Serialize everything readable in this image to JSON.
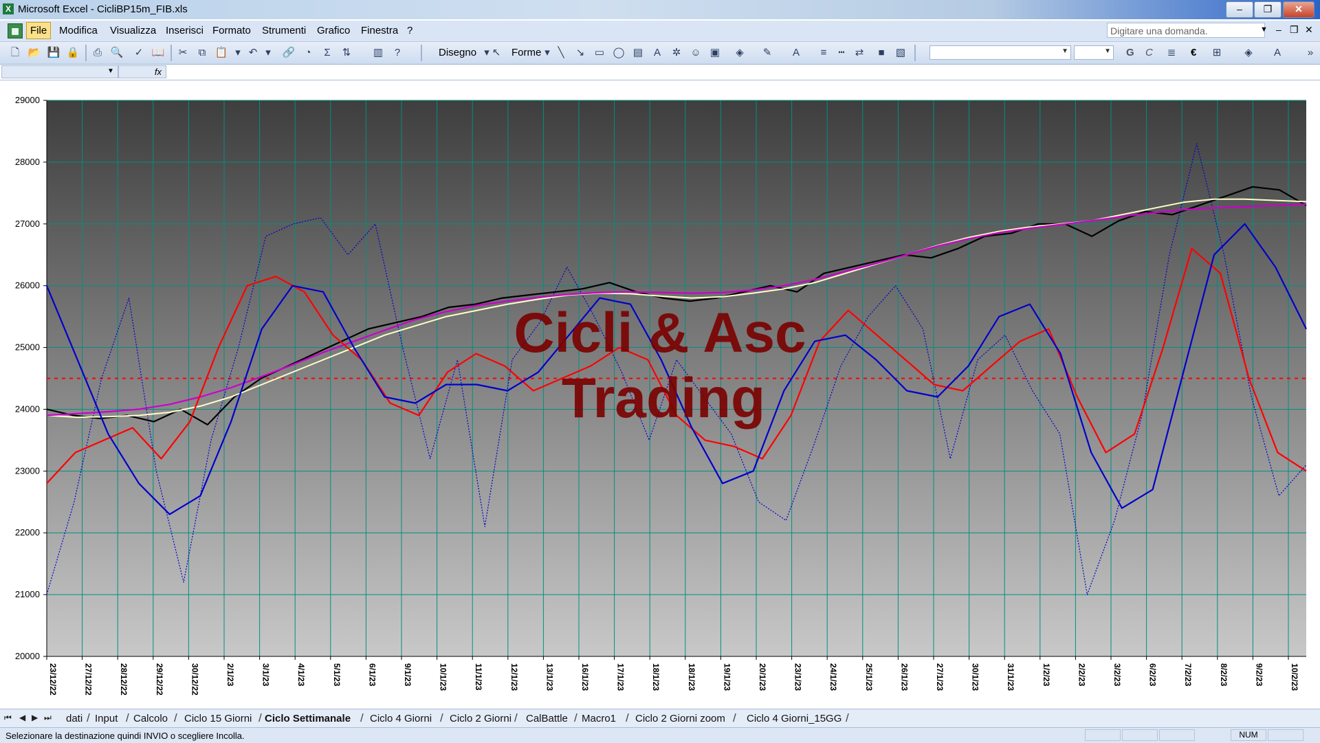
{
  "window": {
    "title": "Microsoft Excel - CicliBP15m_FIB.xls"
  },
  "menu": {
    "items": [
      "File",
      "Modifica",
      "Visualizza",
      "Inserisci",
      "Formato",
      "Strumenti",
      "Grafico",
      "Finestra",
      "?"
    ],
    "help_placeholder": "Digitare una domanda."
  },
  "toolbar": {
    "draw_label": "Disegno",
    "shapes_label": "Forme",
    "bold": "G",
    "italic": "C",
    "euro": "€"
  },
  "chart_data": {
    "type": "line",
    "title": "",
    "watermark": [
      "Cicli & Asc",
      "Trading"
    ],
    "y_ticks": [
      20000,
      21000,
      22000,
      23000,
      24000,
      25000,
      26000,
      27000,
      28000,
      29000
    ],
    "ylim": [
      20000,
      29000
    ],
    "x_tick_labels": [
      "23/12/22",
      "27/12/22",
      "28/12/22",
      "29/12/22",
      "30/12/22",
      "2/1/23",
      "3/1/23",
      "4/1/23",
      "5/1/23",
      "6/1/23",
      "9/1/23",
      "10/1/23",
      "11/1/23",
      "12/1/23",
      "13/1/23",
      "16/1/23",
      "17/1/23",
      "18/1/23",
      "18/1/23",
      "19/1/23",
      "20/1/23",
      "23/1/23",
      "24/1/23",
      "25/1/23",
      "26/1/23",
      "27/1/23",
      "30/1/23",
      "31/1/23",
      "1/2/23",
      "2/2/23",
      "3/2/23",
      "6/2/23",
      "7/2/23",
      "8/2/23",
      "9/2/23",
      "10/2/23"
    ],
    "reference_line": {
      "value": 24500,
      "color": "#ff0000",
      "style": "dashed"
    },
    "series": [
      {
        "color": "#000000",
        "style": "solid",
        "values": [
          24000,
          23900,
          23850,
          23900,
          23800,
          24000,
          23750,
          24200,
          24500,
          24700,
          24900,
          25100,
          25300,
          25400,
          25500,
          25650,
          25700,
          25800,
          25850,
          25900,
          25950,
          26050,
          25900,
          25800,
          25750,
          25800,
          25900,
          26000,
          25900,
          26200,
          26300,
          26400,
          26500,
          26450,
          26600,
          26800,
          26850,
          27000,
          27000,
          26800,
          27050,
          27200,
          27150,
          27300,
          27450,
          27600,
          27550,
          27300
        ]
      },
      {
        "color": "#ffffcc",
        "style": "solid",
        "values": [
          23900,
          23870,
          23880,
          23900,
          23950,
          24050,
          24200,
          24400,
          24600,
          24800,
          25000,
          25200,
          25350,
          25500,
          25600,
          25700,
          25780,
          25850,
          25880,
          25870,
          25830,
          25800,
          25820,
          25880,
          25950,
          26050,
          26200,
          26350,
          26500,
          26650,
          26780,
          26880,
          26950,
          27000,
          27050,
          27150,
          27250,
          27350,
          27400,
          27400,
          27380,
          27360
        ]
      },
      {
        "color": "#cc00cc",
        "style": "solid",
        "values": [
          23900,
          23930,
          23960,
          24000,
          24080,
          24200,
          24350,
          24530,
          24720,
          24920,
          25100,
          25280,
          25450,
          25580,
          25680,
          25750,
          25810,
          25860,
          25890,
          25900,
          25890,
          25880,
          25890,
          25930,
          26000,
          26100,
          26230,
          26360,
          26500,
          26640,
          26760,
          26860,
          26930,
          26990,
          27050,
          27120,
          27180,
          27230,
          27260,
          27280,
          27300,
          27320
        ]
      },
      {
        "color": "#ff0000",
        "style": "solid",
        "values": [
          22800,
          23300,
          23500,
          23700,
          23200,
          23800,
          25000,
          26000,
          26150,
          25900,
          25200,
          24800,
          24100,
          23900,
          24600,
          24900,
          24700,
          24300,
          24500,
          24700,
          25000,
          24800,
          23900,
          23500,
          23400,
          23200,
          23900,
          25100,
          25600,
          25200,
          24800,
          24400,
          24300,
          24700,
          25100,
          25300,
          24200,
          23300,
          23600,
          25000,
          26600,
          26200,
          24500,
          23300,
          23000
        ]
      },
      {
        "color": "#0000cc",
        "style": "solid",
        "values": [
          26000,
          24800,
          23600,
          22800,
          22300,
          22600,
          23800,
          25300,
          26000,
          25900,
          25000,
          24200,
          24100,
          24400,
          24400,
          24300,
          24600,
          25200,
          25800,
          25700,
          24800,
          23700,
          22800,
          23000,
          24300,
          25100,
          25200,
          24800,
          24300,
          24200,
          24700,
          25500,
          25700,
          24900,
          23300,
          22400,
          22700,
          24600,
          26500,
          27000,
          26300,
          25300
        ]
      },
      {
        "color": "#0000cc",
        "style": "dotted",
        "values": [
          21000,
          22500,
          24500,
          25800,
          23000,
          21200,
          23500,
          25000,
          26800,
          27000,
          27100,
          26500,
          27000,
          25000,
          23200,
          24800,
          22100,
          24800,
          25400,
          26300,
          25500,
          24600,
          23500,
          24800,
          24200,
          23600,
          22500,
          22200,
          23400,
          24700,
          25500,
          26000,
          25300,
          23200,
          24800,
          25200,
          24300,
          23600,
          21000,
          22200,
          23900,
          26500,
          28300,
          26500,
          24200,
          22600,
          23100
        ]
      }
    ]
  },
  "sheet_tabs": [
    "dati",
    "Input",
    "Calcolo",
    "Ciclo 15 Giorni",
    "Ciclo Settimanale",
    "Ciclo 4 Giorni",
    "Ciclo 2 Giorni",
    "CalBattle",
    "Macro1",
    "Ciclo 2 Giorni zoom",
    "Ciclo 4 Giorni_15GG"
  ],
  "active_sheet": "Ciclo Settimanale",
  "status": {
    "message": "Selezionare la destinazione quindi INVIO o scegliere Incolla.",
    "num": "NUM"
  }
}
